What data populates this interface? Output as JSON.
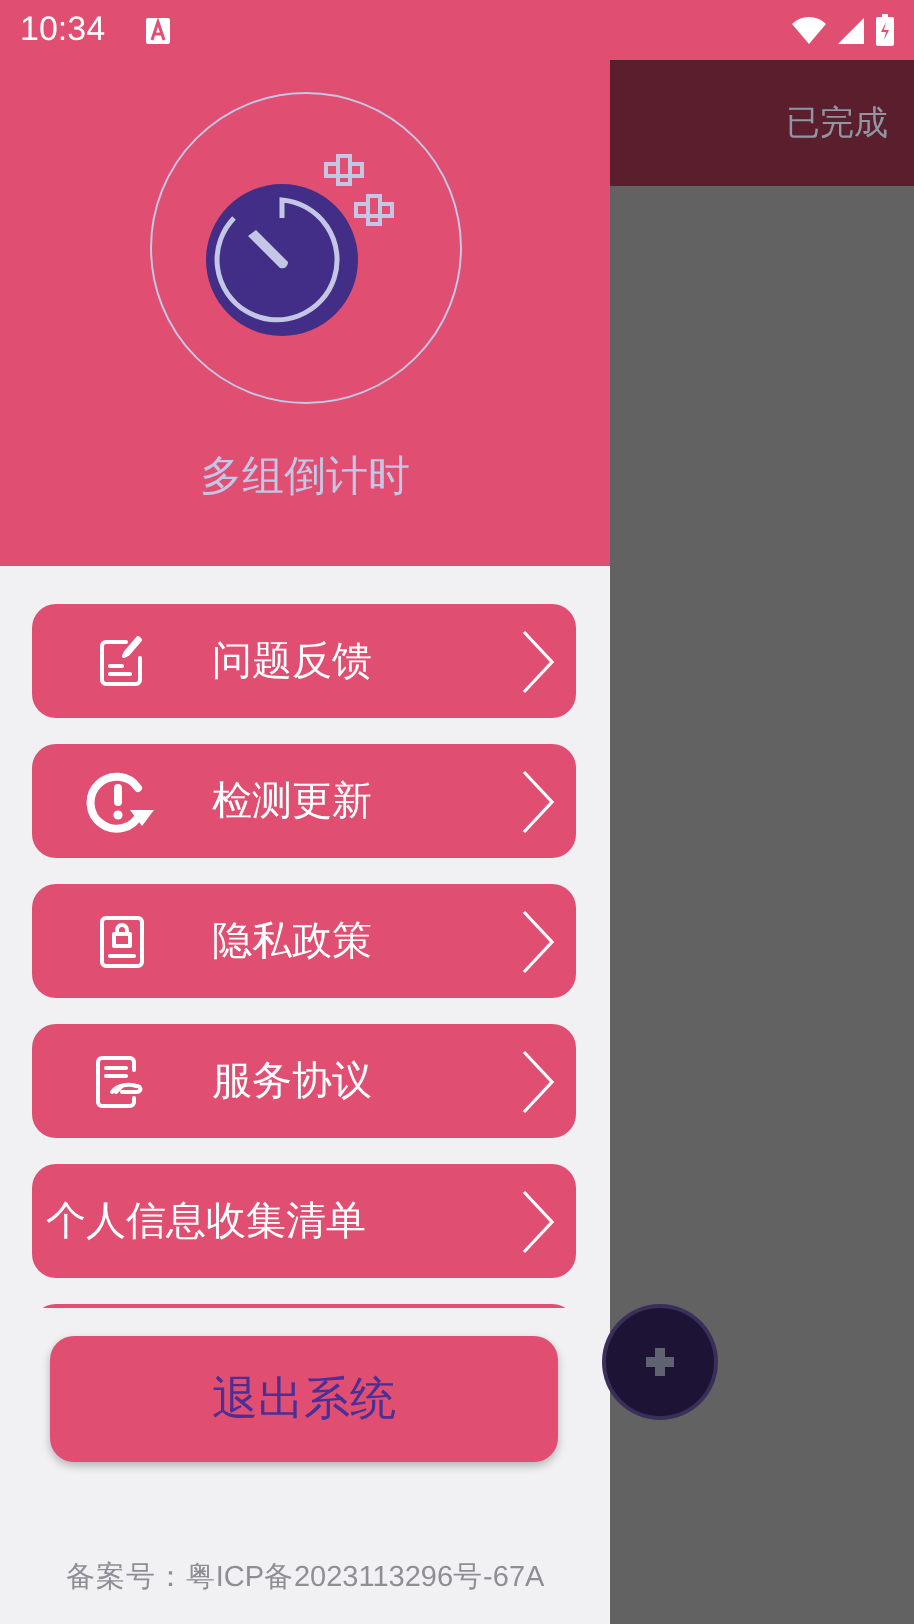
{
  "status_bar": {
    "time": "10:34"
  },
  "drawer": {
    "app_name": "多组倒计时",
    "menu": [
      {
        "label": "问题反馈",
        "kind": "feedback"
      },
      {
        "label": "检测更新",
        "kind": "update"
      },
      {
        "label": "隐私政策",
        "kind": "privacy"
      },
      {
        "label": "服务协议",
        "kind": "agreement"
      },
      {
        "label": "个人信息收集清单",
        "kind": "plain"
      }
    ],
    "logout": "退出系统",
    "footer": "备案号：粤ICP备2023113296号-67A"
  },
  "background": {
    "tab": "已完成"
  }
}
